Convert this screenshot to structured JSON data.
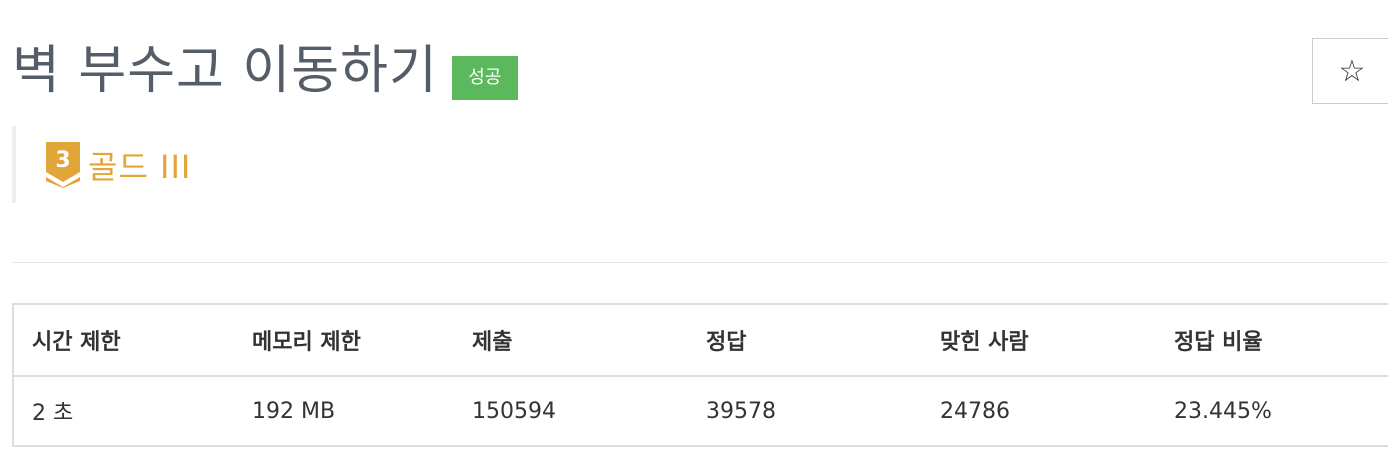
{
  "problem": {
    "title": "벽 부수고 이동하기",
    "result_badge": "성공",
    "favorite_icon": "☆",
    "tier": {
      "number": "3",
      "label": "골드 III",
      "color": "#e1a53a"
    }
  },
  "colors": {
    "success": "#5cb85c",
    "title": "#555d68",
    "tier": "#e1a53a"
  },
  "table": {
    "headers": [
      "시간 제한",
      "메모리 제한",
      "제출",
      "정답",
      "맞힌 사람",
      "정답 비율"
    ],
    "row": [
      "2 초",
      "192 MB",
      "150594",
      "39578",
      "24786",
      "23.445%"
    ]
  }
}
